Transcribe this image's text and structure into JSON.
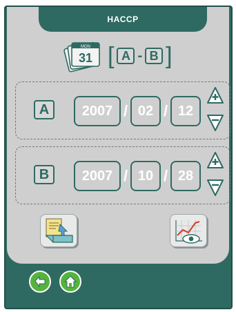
{
  "header": {
    "title": "HACCP"
  },
  "title_row": {
    "calendar_icon": "calendar-stack-icon",
    "calendar_day": "31",
    "calendar_month": "MON",
    "range_a": "A",
    "range_sep": "-",
    "range_b": "B"
  },
  "range_a": {
    "tag": "A",
    "year": "2007",
    "month": "02",
    "day": "12",
    "sep": "/"
  },
  "range_b": {
    "tag": "B",
    "year": "2007",
    "month": "10",
    "day": "28",
    "sep": "/"
  },
  "icons": {
    "increase": "plus-icon",
    "decrease": "minus-icon",
    "export": "export-icon",
    "view": "chart-view-icon",
    "back": "back-icon",
    "home": "home-icon"
  },
  "colors": {
    "accent": "#2e6a62",
    "panel": "#cfcfcf",
    "nav_green": "#56b33d"
  }
}
